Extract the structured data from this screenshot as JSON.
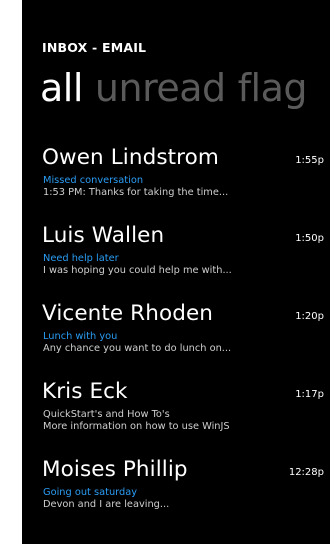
{
  "app": {
    "title": "INBOX - EMAIL"
  },
  "pivot": {
    "tabs": [
      "all",
      "unread",
      "flag"
    ],
    "active_index": 0
  },
  "colors": {
    "background": "#000000",
    "accent": "#2a9df4",
    "inactive_tab": "#5a5a5a"
  },
  "messages": [
    {
      "sender": "Owen Lindstrom",
      "time": "1:55p",
      "subject": "Missed conversation",
      "subject_highlighted": true,
      "preview": "1:53 PM: Thanks for taking the time..."
    },
    {
      "sender": "Luis Wallen",
      "time": "1:50p",
      "subject": "Need help later",
      "subject_highlighted": true,
      "preview": "I was hoping you could help me with..."
    },
    {
      "sender": "Vicente Rhoden",
      "time": "1:20p",
      "subject": "Lunch with you",
      "subject_highlighted": true,
      "preview": "Any chance you want to do lunch on..."
    },
    {
      "sender": "Kris Eck",
      "time": "1:17p",
      "subject": "QuickStart's and How To's",
      "subject_highlighted": false,
      "preview": "More information on how to use WinJS"
    },
    {
      "sender": "Moises Phillip",
      "time": "12:28p",
      "subject": "Going out saturday",
      "subject_highlighted": true,
      "preview": "Devon and I are leaving..."
    }
  ]
}
